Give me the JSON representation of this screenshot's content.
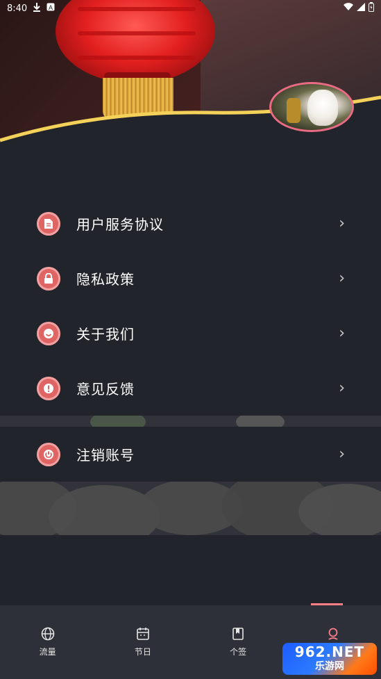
{
  "status_bar": {
    "time": "8:40",
    "icons": [
      "download-icon",
      "a-icon"
    ],
    "right_icons": [
      "wifi-icon",
      "signal-icon",
      "battery-icon"
    ]
  },
  "menu": {
    "items": [
      {
        "label": "用户服务协议",
        "icon": "document-icon"
      },
      {
        "label": "隐私政策",
        "icon": "lock-icon"
      },
      {
        "label": "关于我们",
        "icon": "smile-icon"
      },
      {
        "label": "意见反馈",
        "icon": "alert-icon"
      },
      {
        "label": "注销账号",
        "icon": "power-icon"
      }
    ],
    "arrow": "›"
  },
  "tabbar": {
    "items": [
      {
        "label": "流量",
        "icon": "globe-icon"
      },
      {
        "label": "节日",
        "icon": "calendar-icon"
      },
      {
        "label": "个签",
        "icon": "bookmark-icon"
      },
      {
        "label": "",
        "icon": "profile-icon"
      }
    ]
  },
  "watermark": {
    "top": "962.NET",
    "bottom": "乐游网"
  },
  "colors": {
    "accent": "#df6565",
    "tab_indicator": "#ff7f87",
    "background": "#22242b"
  }
}
